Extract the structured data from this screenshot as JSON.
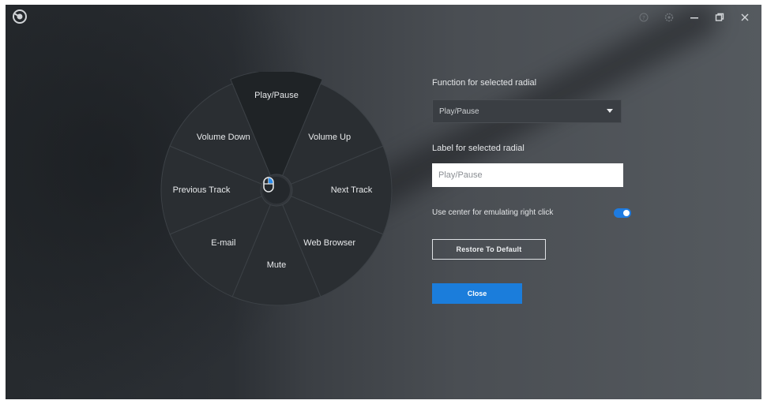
{
  "window": {
    "controls": {
      "help_icon": "help-icon",
      "settings_icon": "gear-icon",
      "minimize_icon": "minimize-icon",
      "restore_icon": "restore-icon",
      "close_icon": "close-icon"
    }
  },
  "radial": {
    "items": [
      {
        "label": "Play/Pause"
      },
      {
        "label": "Volume Up"
      },
      {
        "label": "Next Track"
      },
      {
        "label": "Web Browser"
      },
      {
        "label": "Mute"
      },
      {
        "label": "E-mail"
      },
      {
        "label": "Previous Track"
      },
      {
        "label": "Volume Down"
      }
    ],
    "selected_index": 0,
    "center_icon": "mouse-icon"
  },
  "panel": {
    "function_label": "Function for selected radial",
    "function_value": "Play/Pause",
    "label_label": "Label for selected radial",
    "label_value": "Play/Pause",
    "center_toggle_label": "Use center for emulating right click",
    "center_toggle_on": true,
    "restore_button": "Restore To Default",
    "close_button": "Close"
  },
  "colors": {
    "accent": "#1b7ddb",
    "selected_slice": "#1f2326",
    "slice": "#2a2e32"
  }
}
